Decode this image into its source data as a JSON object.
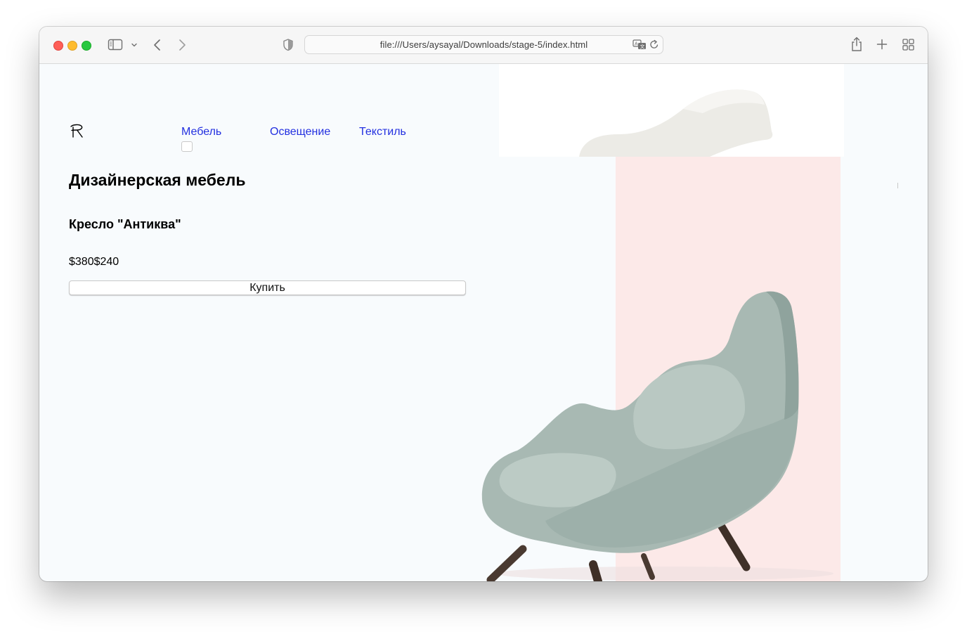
{
  "browser": {
    "url": "file:///Users/aysayal/Downloads/stage-5/index.html",
    "icons": [
      "close-light",
      "minimize-light",
      "zoom-light",
      "sidebar-icon",
      "chevron-down-icon",
      "back-arrow-icon",
      "forward-arrow-icon",
      "shield-icon",
      "translate-icon",
      "reload-icon",
      "share-icon",
      "plus-icon",
      "tab-overview-icon"
    ]
  },
  "site": {
    "logo": "logo-mark-icon",
    "nav": [
      {
        "label": "Мебель"
      },
      {
        "label": "Освещение"
      },
      {
        "label": "Текстиль"
      }
    ],
    "heading": "Дизайнерская мебель",
    "product": {
      "title": "Кресло \"Антиква\"",
      "old_price": "$380",
      "price": "$240",
      "buy_label": "Купить"
    },
    "colors": {
      "background": "#f8fbfd",
      "link": "#2330e0",
      "accent_panel": "#fce9e8",
      "chair": "#a9bab4"
    }
  }
}
